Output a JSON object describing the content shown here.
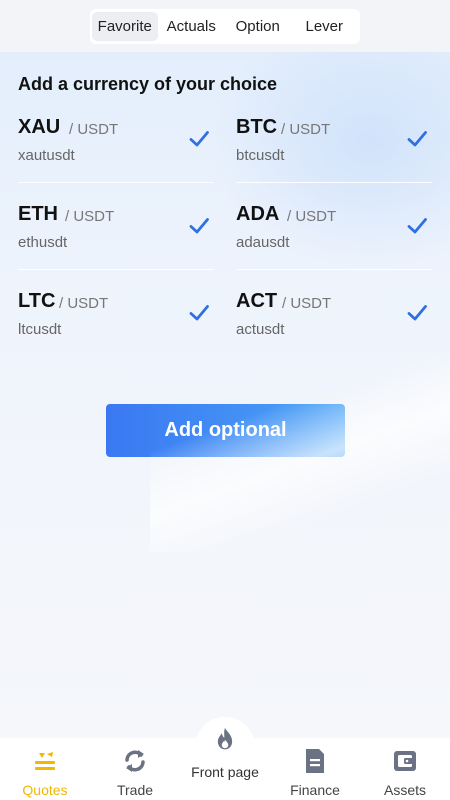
{
  "tabs": [
    {
      "label": "Favorite",
      "active": true
    },
    {
      "label": "Actuals",
      "active": false
    },
    {
      "label": "Option",
      "active": false
    },
    {
      "label": "Lever",
      "active": false
    }
  ],
  "heading": "Add a currency of your choice",
  "currencies": [
    {
      "symbol": "XAU",
      "quote": "/ USDT",
      "code": "xautusdt",
      "checked": true
    },
    {
      "symbol": "BTC",
      "quote": "/ USDT",
      "code": "btcusdt",
      "checked": true
    },
    {
      "symbol": "ETH",
      "quote": "/ USDT",
      "code": "ethusdt",
      "checked": true
    },
    {
      "symbol": "ADA",
      "quote": "/ USDT",
      "code": "adausdt",
      "checked": true
    },
    {
      "symbol": "LTC",
      "quote": "/ USDT",
      "code": "ltcusdt",
      "checked": true
    },
    {
      "symbol": "ACT",
      "quote": "/ USDT",
      "code": "actusdt",
      "checked": true
    }
  ],
  "add_button_label": "Add optional",
  "nav": [
    {
      "label": "Quotes",
      "icon": "quotes-icon",
      "active": true
    },
    {
      "label": "Trade",
      "icon": "refresh-icon",
      "active": false
    },
    {
      "label": "Front page",
      "icon": "flame-icon",
      "active": false
    },
    {
      "label": "Finance",
      "icon": "document-icon",
      "active": false
    },
    {
      "label": "Assets",
      "icon": "wallet-icon",
      "active": false
    }
  ],
  "colors": {
    "accent_blue": "#2f6fe0",
    "button_start": "#3a78f2",
    "button_end": "#4aa3f7",
    "nav_active": "#f0b800",
    "nav_icon": "#6b7284"
  }
}
